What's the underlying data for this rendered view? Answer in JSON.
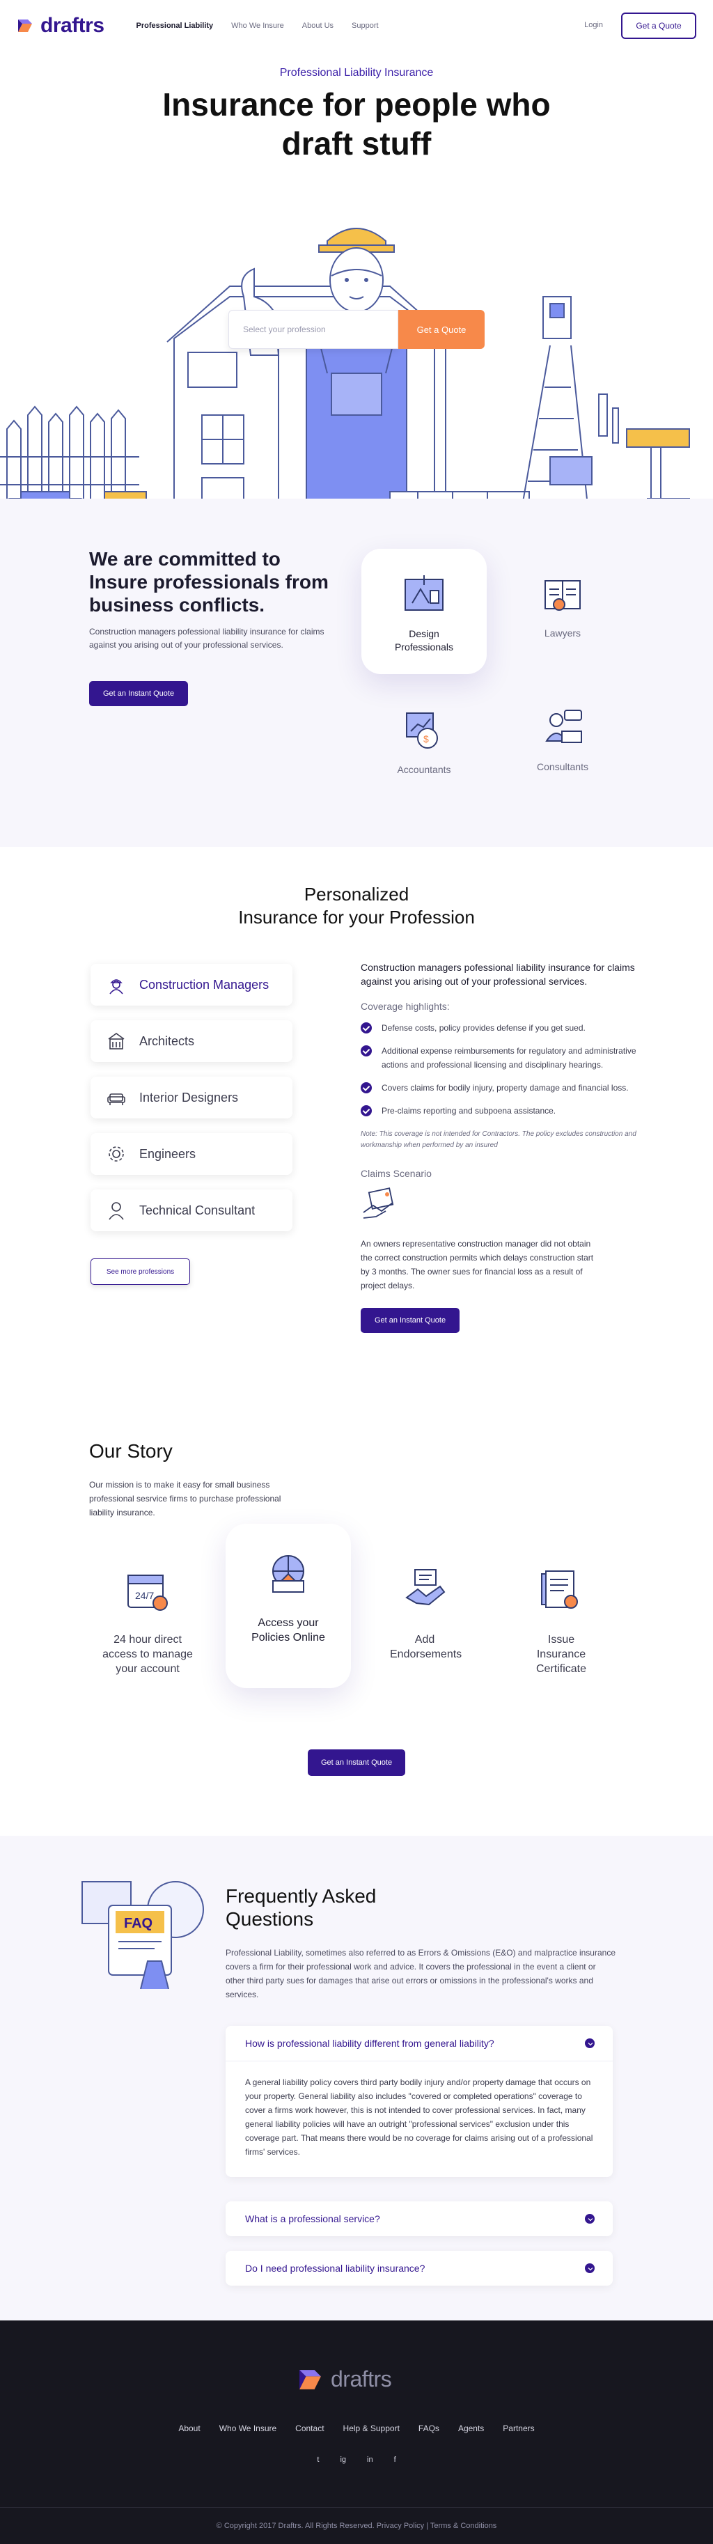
{
  "header": {
    "logo_text": "draftrs",
    "nav": [
      "Professional Liability",
      "Who We Insure",
      "About Us",
      "Support"
    ],
    "login_label": "Login",
    "quote_label": "Get a Quote"
  },
  "hero": {
    "eyebrow": "Professional Liability Insurance",
    "title_line1": "Insurance for people who",
    "title_line2": "draft stuff",
    "select_placeholder": "Select your profession",
    "button_label": "Get a Quote"
  },
  "commit": {
    "title": "We are committed to Insure professionals from business conflicts.",
    "body": "Construction managers pofessional liability insurance for claims against you arising out of your professional services.",
    "button_label": "Get an Instant Quote",
    "professions": [
      "Design Professionals",
      "Lawyers",
      "Accountants",
      "Consultants"
    ]
  },
  "personalized": {
    "title_line1": "Personalized",
    "title_line2": "Insurance for your Profession",
    "list": [
      "Construction Managers",
      "Architects",
      "Interior Designers",
      "Engineers",
      "Technical Consultant"
    ],
    "see_more_label": "See more professions",
    "intro": "Construction managers pofessional liability insurance for claims against you arising out of your professional services.",
    "coverage_heading": "Coverage highlights:",
    "coverage": [
      "Defense costs, policy provides defense if you get sued.",
      "Additional expense reimbursements for regulatory and administrative actions and professional licensing and disciplinary hearings.",
      "Covers claims for bodily injury, property damage and financial loss.",
      "Pre-claims reporting and subpoena assistance."
    ],
    "note": "Note: This coverage is not intended for Contractors. The policy excludes construction and workmanship when performed by an insured",
    "claims_heading": "Claims Scenario",
    "claims_text": "An owners representative construction manager did not obtain the correct construction permits which delays construction start by 3 months. The owner sues for financial loss as a result of project delays.",
    "button_label": "Get an Instant Quote"
  },
  "story": {
    "title": "Our Story",
    "body": "Our mission is to make it easy for small business professional sesrvice firms to purchase professional liability insurance.",
    "features": [
      "24 hour direct access to manage your account",
      "Access your Policies Online",
      "Add Endorsements",
      "Issue Insurance Certificate"
    ],
    "calendar_label": "24/7",
    "button_label": "Get an Instant Quote"
  },
  "faq": {
    "illus_label": "FAQ",
    "title_line1": "Frequently Asked",
    "title_line2": "Questions",
    "description": "Professional Liability, sometimes also referred to as Errors & Omissions (E&O) and malpractice insurance covers a firm for their professional work and advice. It covers the professional in the event a client or other third party sues for damages that arise out errors or omissions in the professional's works and services.",
    "questions": [
      {
        "q": "How is professional liability different from general liability?",
        "a": "A general liability policy covers third party bodily injury and/or property damage that occurs on your property. General liability also includes \"covered or completed operations\" coverage to cover a firms work however, this is not intended to cover professional services. In fact, many general liability policies will have an outright \"professional services\" exclusion under this coverage part. That means there would be no coverage for claims arising out of a professional firms' services."
      },
      {
        "q": "What is a professional service?"
      },
      {
        "q": "Do I need professional liability insurance?"
      }
    ]
  },
  "footer": {
    "logo_text": "draftrs",
    "links": [
      "About",
      "Who We Insure",
      "Contact",
      "Help & Support",
      "FAQs",
      "Agents",
      "Partners"
    ],
    "social": [
      "t",
      "ig",
      "in",
      "f"
    ],
    "copyright": "© Copyright 2017 Draftrs. All Rights Reserved. Privacy Policy  |  Terms & Conditions"
  },
  "colors": {
    "brand": "#33168f",
    "accent": "#f7894a",
    "illus_blue": "#7e8ff2",
    "illus_yellow": "#f5c04a"
  }
}
